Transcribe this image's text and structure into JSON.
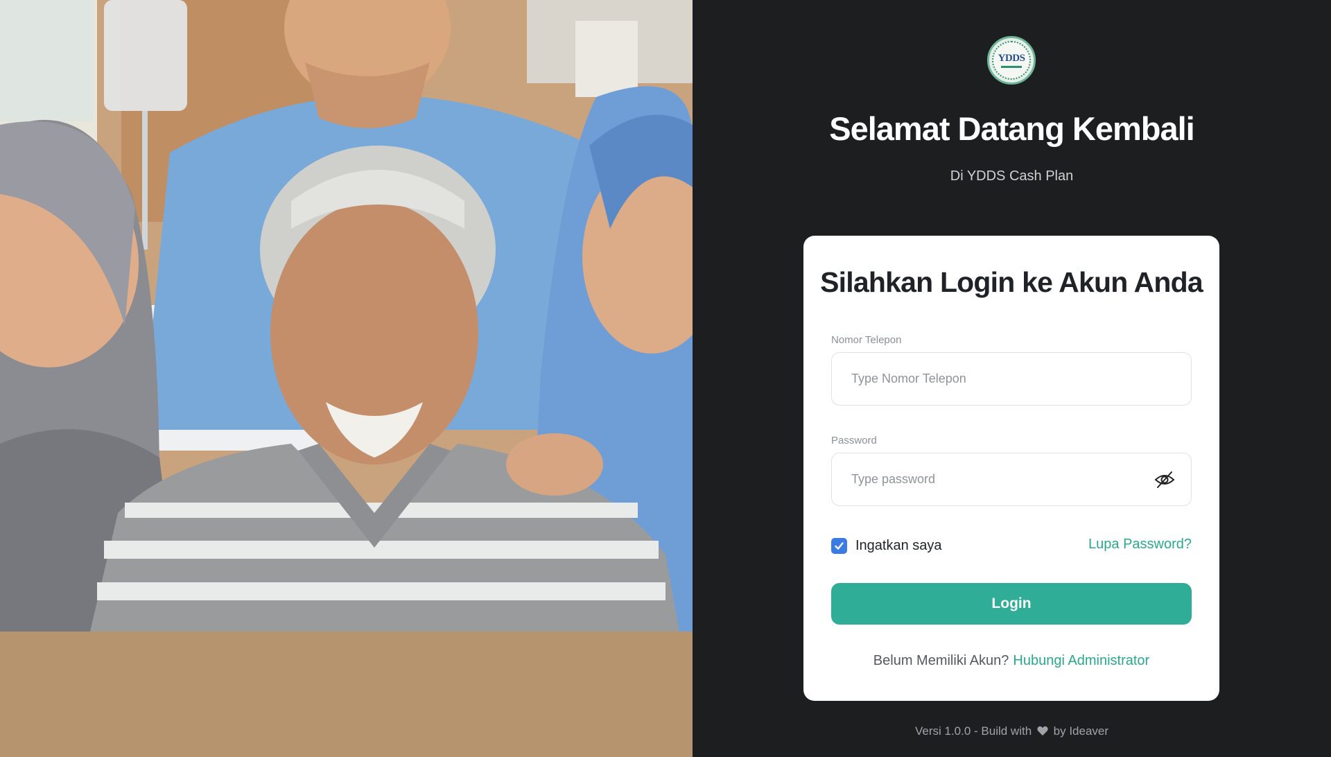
{
  "hero": {
    "image_alt": "Elderly man smiling with healthcare staff"
  },
  "brand": {
    "logo_text": "YDDS",
    "primary_color": "#2fad96",
    "checkbox_color": "#3b7be4",
    "background_color": "#1d1e20"
  },
  "header": {
    "title": "Selamat Datang Kembali",
    "subtitle": "Di YDDS Cash Plan"
  },
  "login_card": {
    "title": "Silahkan Login ke Akun Anda",
    "phone": {
      "label": "Nomor Telepon",
      "value": "",
      "placeholder": "Type Nomor Telepon"
    },
    "password": {
      "label": "Password",
      "value": "",
      "placeholder": "Type password",
      "toggle_icon": "eye-slash-icon"
    },
    "remember": {
      "label": "Ingatkan saya",
      "checked": true
    },
    "forgot_label": "Lupa Password?",
    "submit_label": "Login",
    "signup_prompt": "Belum Memiliki Akun?",
    "signup_link": "Hubungi Administrator"
  },
  "footer": {
    "prefix": "Versi 1.0.0 - Build with",
    "suffix": "by Ideaver",
    "icon": "heart-icon"
  }
}
